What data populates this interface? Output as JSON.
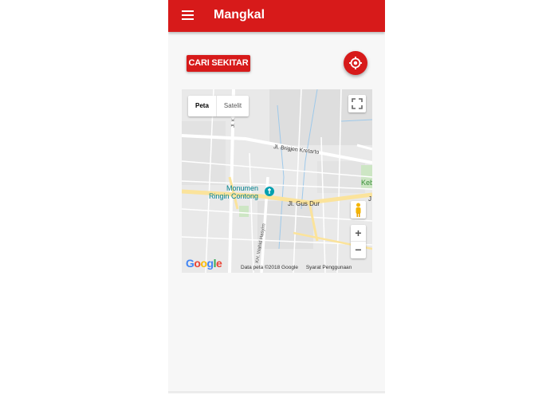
{
  "app": {
    "title": "Mangkal"
  },
  "actions": {
    "search_nearby_label": "CARI SEKITAR",
    "locate_icon": "my-location-icon"
  },
  "map": {
    "type_control": {
      "map_label": "Peta",
      "satellite_label": "Satelit",
      "selected": "Peta"
    },
    "labels": {
      "street_1": "Jl. Brigjen Kretarto",
      "street_2": "Jl. Gus Dur",
      "street_3": "KH. Wahid Hasyim",
      "street_4": "Jl. K",
      "poi_line1": "Monumen",
      "poi_line2": "Ringin Contong",
      "edge_label": "Keb",
      "edge_label_2": "J"
    },
    "logo": "Google",
    "attribution": "Data peta ©2018 Google",
    "terms": "Syarat Penggunaan",
    "zoom_in": "+",
    "zoom_out": "−"
  },
  "colors": {
    "primary": "#d71a1a",
    "major_road": "#fbe39b",
    "water": "#9ec9ea",
    "poi": "#00a0b0"
  }
}
